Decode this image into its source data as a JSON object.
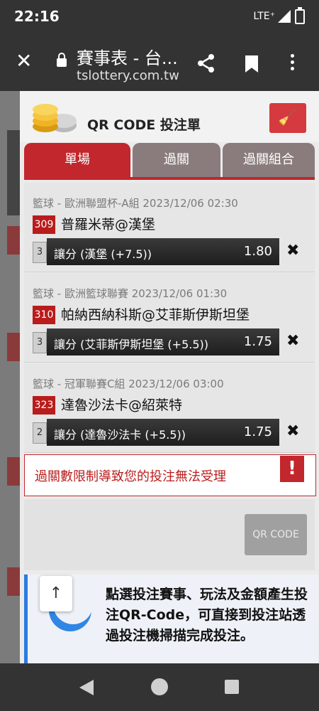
{
  "status": {
    "time": "22:16",
    "network": "LTE⁺"
  },
  "browser": {
    "page_title": "賽事表 - 台...",
    "domain": "tslottery.com.tw"
  },
  "panel": {
    "title": "QR CODE 投注單",
    "tabs": [
      {
        "label": "單場",
        "active": true
      },
      {
        "label": "過關",
        "active": false
      },
      {
        "label": "過關組合",
        "active": false
      }
    ],
    "bets": [
      {
        "meta": "籃球 - 歐洲聯盟杯-A組 2023/12/06 02:30",
        "num": "309",
        "match": "普羅米蒂@漢堡",
        "count": "3",
        "pick": "讓分 (漢堡 (+7.5))",
        "odd": "1.80"
      },
      {
        "meta": "籃球 - 歐洲籃球聯賽 2023/12/06 01:30",
        "num": "310",
        "match": "帕納西納科斯@艾菲斯伊斯坦堡",
        "count": "3",
        "pick": "讓分 (艾菲斯伊斯坦堡 (+5.5))",
        "odd": "1.75"
      },
      {
        "meta": "籃球 - 冠軍聯賽C組 2023/12/06 03:00",
        "num": "323",
        "match": "達魯沙法卡@紹萊特",
        "count": "2",
        "pick": "讓分 (達魯沙法卡 (+5.5))",
        "odd": "1.75"
      }
    ],
    "alert": {
      "message": "過關數限制導致您的投注無法受理",
      "icon_text": "!"
    },
    "qr_button": "QR CODE",
    "info_text": "點選投注賽事、玩法及金額產生投注QR-Code，可直接到投注站透過投注機掃描完成投注。",
    "up_arrow": "↑"
  },
  "colors": {
    "accent_red": "#c1272d",
    "info_blue": "#2d7be0"
  }
}
